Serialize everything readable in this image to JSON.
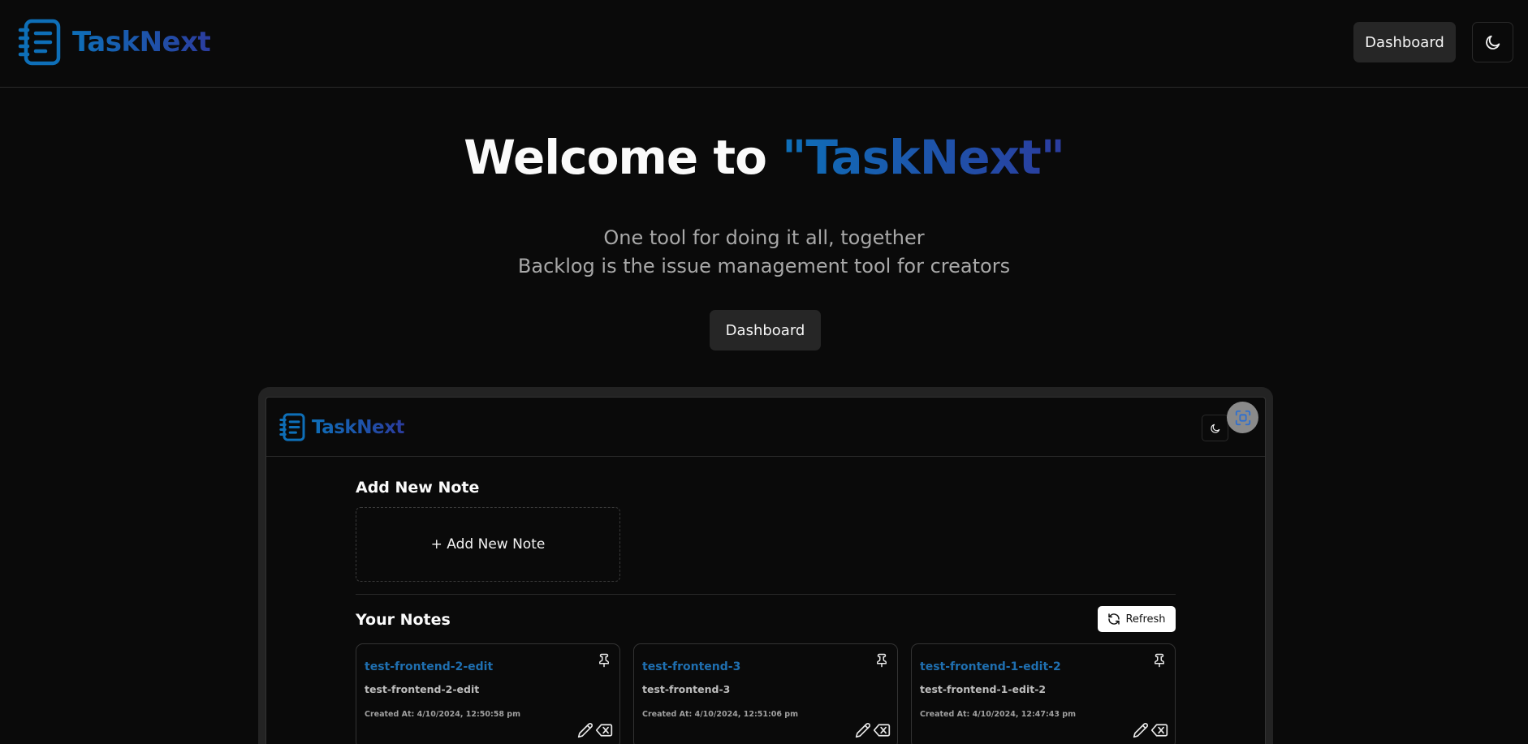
{
  "nav": {
    "brand": "TaskNext",
    "dashboard_label": "Dashboard",
    "theme_icon": "moon-icon"
  },
  "hero": {
    "title_prefix": "Welcome to ",
    "title_highlight": "\"TaskNext\"",
    "subtitle_line1": "One tool for doing it all, together",
    "subtitle_line2": "Backlog is the issue management tool for creators",
    "dashboard_label": "Dashboard"
  },
  "preview": {
    "brand": "TaskNext",
    "add_section_title": "Add New Note",
    "add_button_label": "+ Add New Note",
    "notes_section_title": "Your Notes",
    "refresh_label": "Refresh",
    "notes": [
      {
        "title": "test-frontend-2-edit",
        "body": "test-frontend-2-edit",
        "created": "Created At: 4/10/2024, 12:50:58 pm"
      },
      {
        "title": "test-frontend-3",
        "body": "test-frontend-3",
        "created": "Created At: 4/10/2024, 12:51:06 pm"
      },
      {
        "title": "test-frontend-1-edit-2",
        "body": "test-frontend-1-edit-2",
        "created": "Created At: 4/10/2024, 12:47:43 pm"
      }
    ]
  },
  "colors": {
    "background": "#0a0a0a",
    "brand_gradient_start": "#0e6fb8",
    "brand_gradient_end": "#2b3c9e",
    "note_title": "#1f6fb0",
    "button_dark": "#262626"
  }
}
